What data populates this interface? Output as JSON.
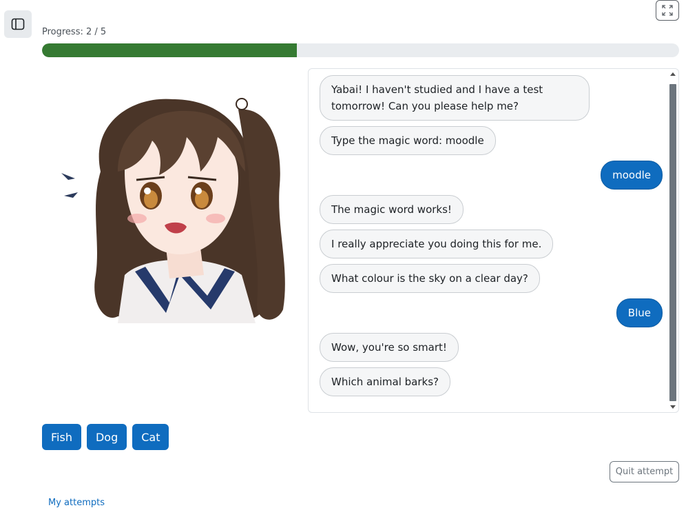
{
  "progress": {
    "label": "Progress: 2 / 5",
    "current": 2,
    "total": 5
  },
  "conversation": [
    {
      "from": "bot",
      "text": "Yabai! I haven't studied and I have a test tomorrow! Can you please help me?"
    },
    {
      "from": "bot",
      "text": "Type the magic word: moodle"
    },
    {
      "from": "user",
      "text": "moodle"
    },
    {
      "from": "bot",
      "text": "The magic word works!"
    },
    {
      "from": "bot",
      "text": "I really appreciate you doing this for me."
    },
    {
      "from": "bot",
      "text": "What colour is the sky on a clear day?"
    },
    {
      "from": "user",
      "text": "Blue"
    },
    {
      "from": "bot",
      "text": "Wow, you're so smart!"
    },
    {
      "from": "bot",
      "text": "Which animal barks?"
    }
  ],
  "answers": [
    "Fish",
    "Dog",
    "Cat"
  ],
  "actions": {
    "quit_label": "Quit attempt",
    "attempts_link": "My attempts"
  },
  "icons": {
    "drawer": "sidebar-toggle-icon",
    "fullscreen": "fullscreen-expand-icon"
  },
  "colors": {
    "progress": "#357a32",
    "primary": "#0f6cbf",
    "bot_bubble": "#f5f6f7"
  }
}
